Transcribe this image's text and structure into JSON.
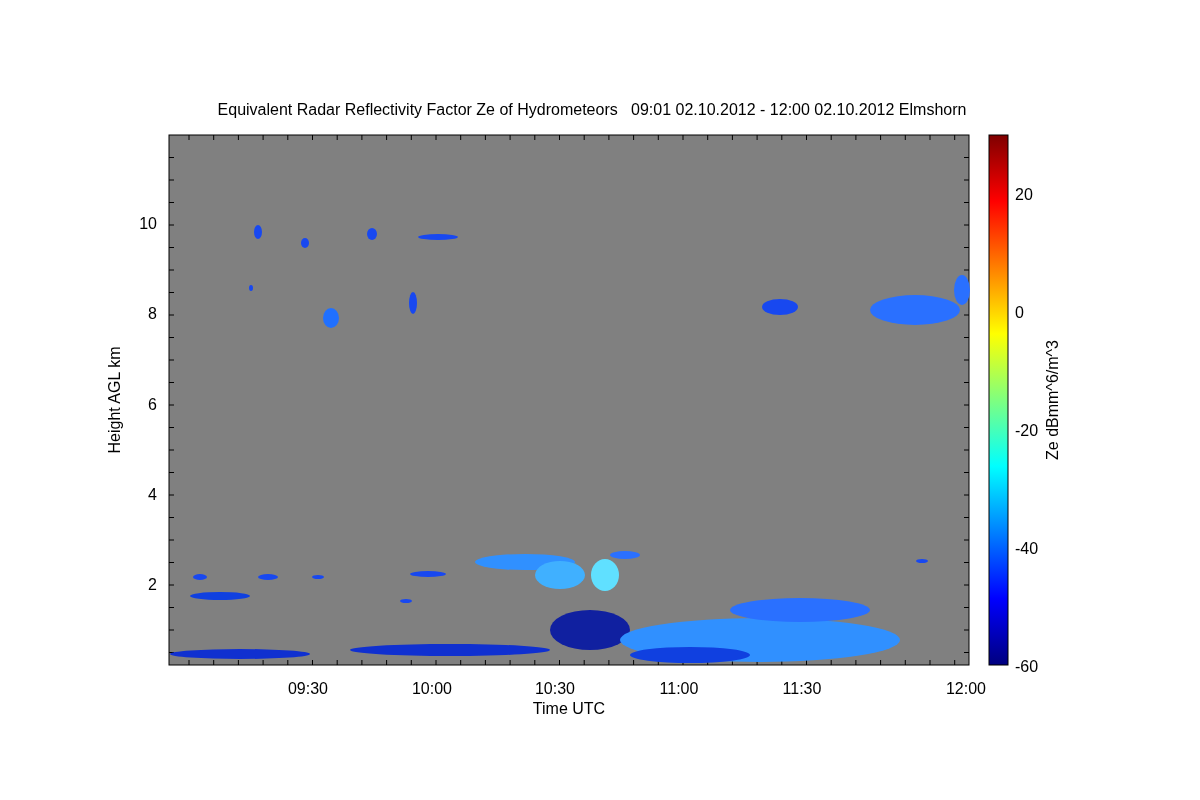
{
  "chart": {
    "title": "Equivalent Radar Reflectivity Factor Ze of Hydrometeors   09:01 02.10.2012 - 12:00 02.10.2012 Elmshorn",
    "xlabel": "Time UTC",
    "ylabel": "Height AGL km",
    "xtick_labels": [
      "09:30",
      "10:00",
      "10:30",
      "11:00",
      "11:30",
      "12:00"
    ],
    "ytick_labels": [
      "10",
      "8",
      "6",
      "4",
      "2"
    ]
  },
  "colorbar": {
    "label": "Ze dBmm^6/m^3",
    "tick_labels": [
      "20",
      "0",
      "-20",
      "-40",
      "-60"
    ]
  }
}
